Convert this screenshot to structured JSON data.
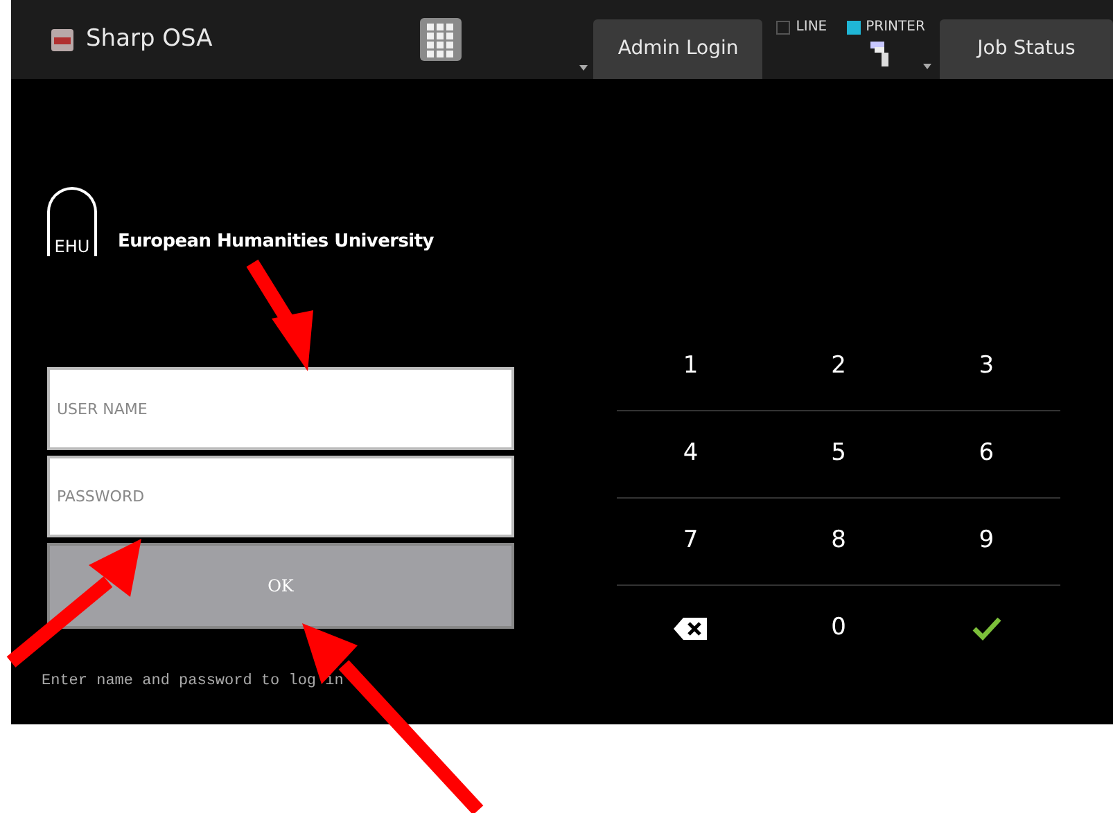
{
  "top_bar": {
    "app_title": "Sharp OSA",
    "admin_button": "Admin Login",
    "indicators": [
      {
        "label": "LINE",
        "on": false
      },
      {
        "label": "PRINTER",
        "on": true
      }
    ],
    "job_status_button": "Job Status"
  },
  "logo": {
    "mark": "EHU",
    "name": "European Humanities University"
  },
  "login": {
    "username": {
      "placeholder": "USER NAME"
    },
    "password": {
      "placeholder": "PASSWORD"
    },
    "ok_button": "OK",
    "hint": "Enter name and password to log in"
  },
  "keypad": [
    {
      "kind": "digit",
      "label": "1"
    },
    {
      "kind": "digit",
      "label": "2"
    },
    {
      "kind": "digit",
      "label": "3"
    },
    {
      "kind": "digit",
      "label": "4"
    },
    {
      "kind": "digit",
      "label": "5"
    },
    {
      "kind": "digit",
      "label": "6"
    },
    {
      "kind": "digit",
      "label": "7"
    },
    {
      "kind": "digit",
      "label": "8"
    },
    {
      "kind": "digit",
      "label": "9"
    },
    {
      "kind": "backspace"
    },
    {
      "kind": "digit",
      "label": "0"
    },
    {
      "kind": "enter"
    }
  ]
}
